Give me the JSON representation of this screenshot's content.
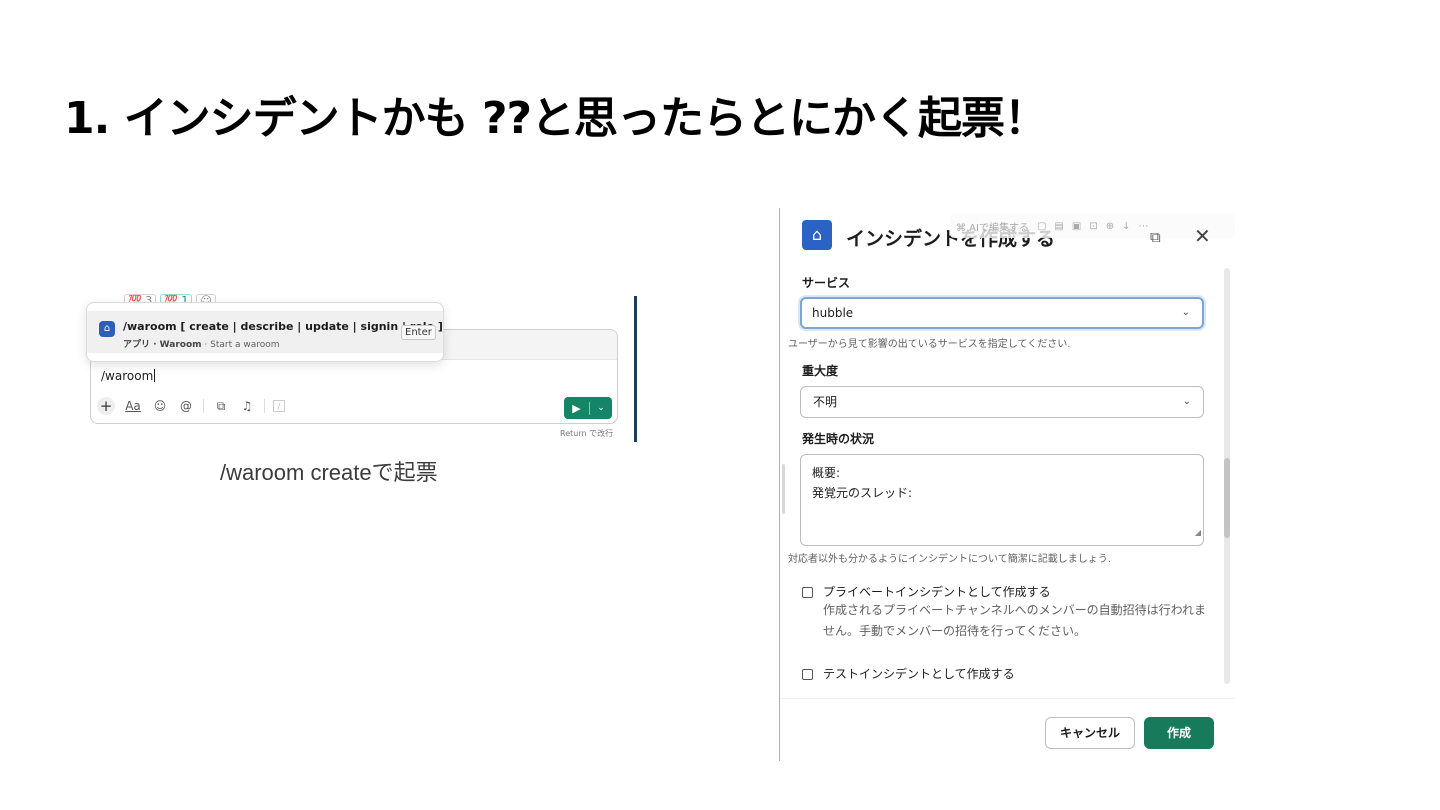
{
  "slide": {
    "title": "1. インシデントかも ??と思ったらとにかく起票！",
    "caption": "/waroom createで起票"
  },
  "slack": {
    "reactions": [
      "💯 3",
      "💯 1",
      "☺"
    ],
    "popup": {
      "command": "/waroom [ create | describe | update | signin | role ]",
      "app_label": "アプリ · Waroom",
      "description": " · Start a waroom",
      "enter_key": "Enter"
    },
    "composer": {
      "value": "/waroom",
      "toolbar": {
        "plus_icon": "+",
        "format_label": "Aa",
        "emoji_icon": "☺",
        "mention_icon": "@",
        "video_icon": "⧉",
        "mic_icon": "♫",
        "slash_icon": "/"
      },
      "send_icon": "▶",
      "send_menu_icon": "⌄",
      "return_hint": "Return で改行"
    }
  },
  "modal": {
    "title": "インシデントを作成する",
    "overlay_text": "⌘ AIで編集する",
    "overlay_icons": [
      "▢",
      "▤",
      "▣",
      "⊡",
      "⊕",
      "↓",
      "⋯"
    ],
    "close_icon": "✕",
    "service": {
      "label": "サービス",
      "value": "hubble",
      "hint": "ユーザーから見て影響の出ているサービスを指定してください."
    },
    "severity": {
      "label": "重大度",
      "value": "不明"
    },
    "situation": {
      "label": "発生時の状況",
      "lines": [
        "概要:",
        "発覚元のスレッド:"
      ],
      "hint": "対応者以外も分かるようにインシデントについて簡潔に記載しましょう."
    },
    "private_incident": {
      "label": "プライベートインシデントとして作成する",
      "description": "作成されるプライベートチャンネルへのメンバーの自動招待は行われません。手動でメンバーの招待を行ってください。",
      "checked": false
    },
    "test_incident": {
      "label": "テストインシデントとして作成する",
      "checked": false
    },
    "buttons": {
      "cancel": "キャンセル",
      "create": "作成"
    },
    "colors": {
      "primary": "#167a5b",
      "app_icon": "#2b63c5"
    }
  }
}
